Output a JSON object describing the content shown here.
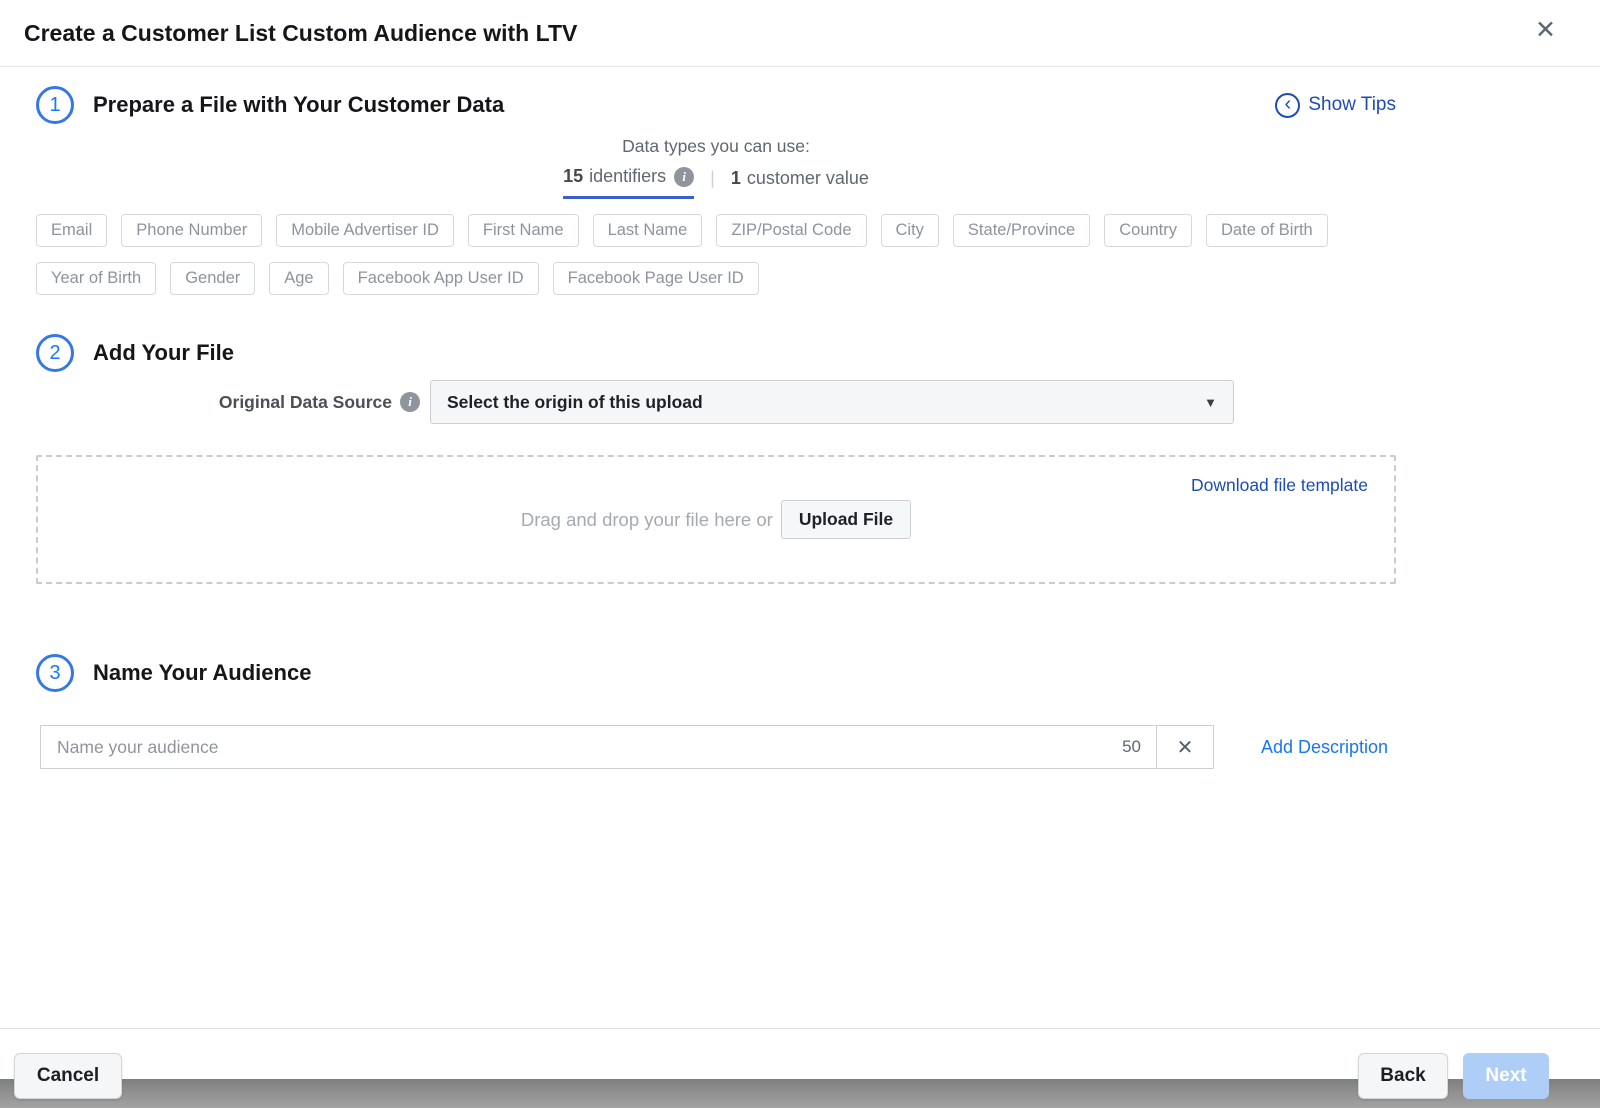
{
  "dialog": {
    "title": "Create a Customer List Custom Audience with LTV"
  },
  "icons": {
    "close": "✕",
    "show_tips_chevron": "‹",
    "info": "i",
    "dropdown_caret": "▼",
    "clear": "✕"
  },
  "steps": {
    "step1": {
      "number": "1",
      "title": "Prepare a File with Your Customer Data"
    },
    "step2": {
      "number": "2",
      "title": "Add Your File"
    },
    "step3": {
      "number": "3",
      "title": "Name Your Audience"
    }
  },
  "show_tips_label": "Show Tips",
  "data_types": {
    "heading": "Data types you can use:",
    "identifiers_count": "15",
    "identifiers_label": "identifiers",
    "separator": "|",
    "customer_value_count": "1",
    "customer_value_label": "customer value"
  },
  "identifier_chips": [
    "Email",
    "Phone Number",
    "Mobile Advertiser ID",
    "First Name",
    "Last Name",
    "ZIP/Postal Code",
    "City",
    "State/Province",
    "Country",
    "Date of Birth",
    "Year of Birth",
    "Gender",
    "Age",
    "Facebook App User ID",
    "Facebook Page User ID"
  ],
  "add_file": {
    "original_data_source_label": "Original Data Source",
    "dropdown_value": "Select the origin of this upload",
    "drop_text": "Drag and drop your file here or",
    "upload_button_label": "Upload File",
    "download_link_label": "Download file template"
  },
  "name_audience": {
    "placeholder": "Name your audience",
    "char_count": "50",
    "add_description_label": "Add Description"
  },
  "footer": {
    "cancel_label": "Cancel",
    "back_label": "Back",
    "next_label": "Next"
  },
  "colors": {
    "accent_blue": "#1877f2",
    "link_navy": "#1e4cb5",
    "step_ring": "#3578e5",
    "identifiers_underline": "#3b5fce",
    "disabled_next": "#aecdf7"
  }
}
